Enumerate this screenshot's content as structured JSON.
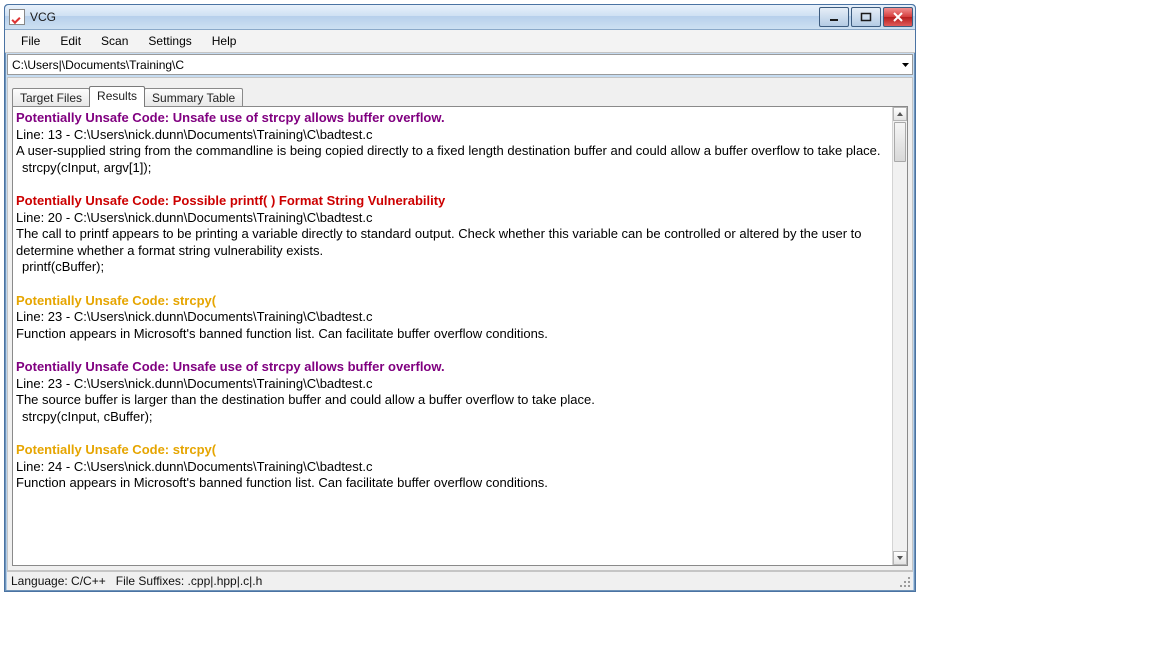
{
  "title": "VCG",
  "menu": {
    "file": "File",
    "edit": "Edit",
    "scan": "Scan",
    "settings": "Settings",
    "help": "Help"
  },
  "path": "C:\\Users|\\Documents\\Training\\C",
  "tabs": {
    "target": "Target Files",
    "results": "Results",
    "summary": "Summary Table"
  },
  "entries": [
    {
      "color": "purple",
      "heading": "Potentially Unsafe Code: Unsafe use of strcpy allows buffer overflow.",
      "line": "Line: 13 - C:\\Users\\nick.dunn\\Documents\\Training\\C\\badtest.c",
      "desc": "A user-supplied string from the commandline is being copied directly to a fixed length destination buffer and could allow a buffer overflow to take place.",
      "code": "  strcpy(cInput, argv[1]);"
    },
    {
      "color": "red",
      "heading": "Potentially Unsafe Code: Possible printf( ) Format String Vulnerability",
      "line": "Line: 20 - C:\\Users\\nick.dunn\\Documents\\Training\\C\\badtest.c",
      "desc": "The call to printf appears to be printing a variable directly to standard output. Check whether this variable can be controlled or altered by the user to determine whether a format string vulnerability exists.",
      "code": "    printf(cBuffer);"
    },
    {
      "color": "orange",
      "heading": "Potentially Unsafe Code: strcpy(",
      "line": "Line: 23 - C:\\Users\\nick.dunn\\Documents\\Training\\C\\badtest.c",
      "desc": "Function appears in Microsoft's banned function list. Can facilitate buffer overflow conditions.",
      "code": ""
    },
    {
      "color": "purple",
      "heading": "Potentially Unsafe Code: Unsafe use of strcpy allows buffer overflow.",
      "line": "Line: 23 - C:\\Users\\nick.dunn\\Documents\\Training\\C\\badtest.c",
      "desc": "The source buffer is larger than the destination buffer and could allow a buffer overflow to take place.",
      "code": "  strcpy(cInput, cBuffer);"
    },
    {
      "color": "orange",
      "heading": "Potentially Unsafe Code: strcpy(",
      "line": "Line: 24 - C:\\Users\\nick.dunn\\Documents\\Training\\C\\badtest.c",
      "desc": "Function appears in Microsoft's banned function list. Can facilitate buffer overflow conditions.",
      "code": ""
    }
  ],
  "status": {
    "lang": "Language: C/C++",
    "suffix": "File Suffixes: .cpp|.hpp|.c|.h"
  }
}
